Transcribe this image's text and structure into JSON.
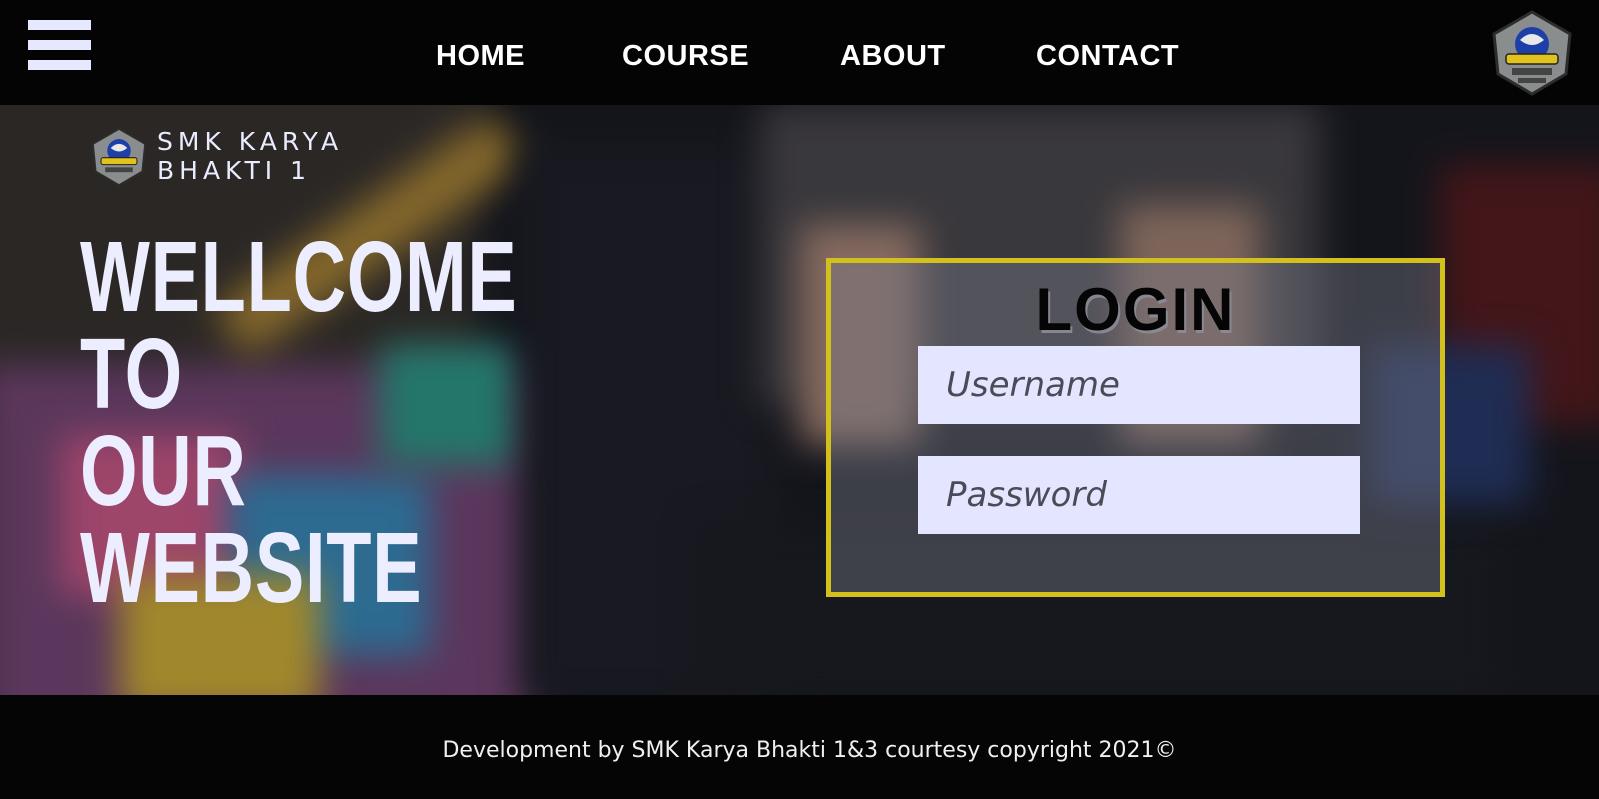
{
  "nav": {
    "links": [
      "HOME",
      "COURSE",
      "ABOUT",
      "CONTACT"
    ],
    "menu_icon": "hamburger-menu-icon",
    "logo_icon": "school-emblem-icon"
  },
  "brand": {
    "line1": "SMK KARYA",
    "line2": "BHAKTI 1",
    "logo_icon": "school-emblem-icon"
  },
  "hero": {
    "welcome_lines": [
      "WELLCOME",
      "TO",
      "OUR",
      "WEBSITE"
    ]
  },
  "login": {
    "title": "LOGIN",
    "username_placeholder": "Username",
    "password_placeholder": "Password"
  },
  "footer": {
    "text": "Development by SMK Karya Bhakti 1&3 courtesy copyright 2021©"
  },
  "colors": {
    "login_border": "#d2c01c",
    "input_bg": "#e4e6ff",
    "text_light": "#eceeff",
    "bar_bg": "#040404"
  }
}
